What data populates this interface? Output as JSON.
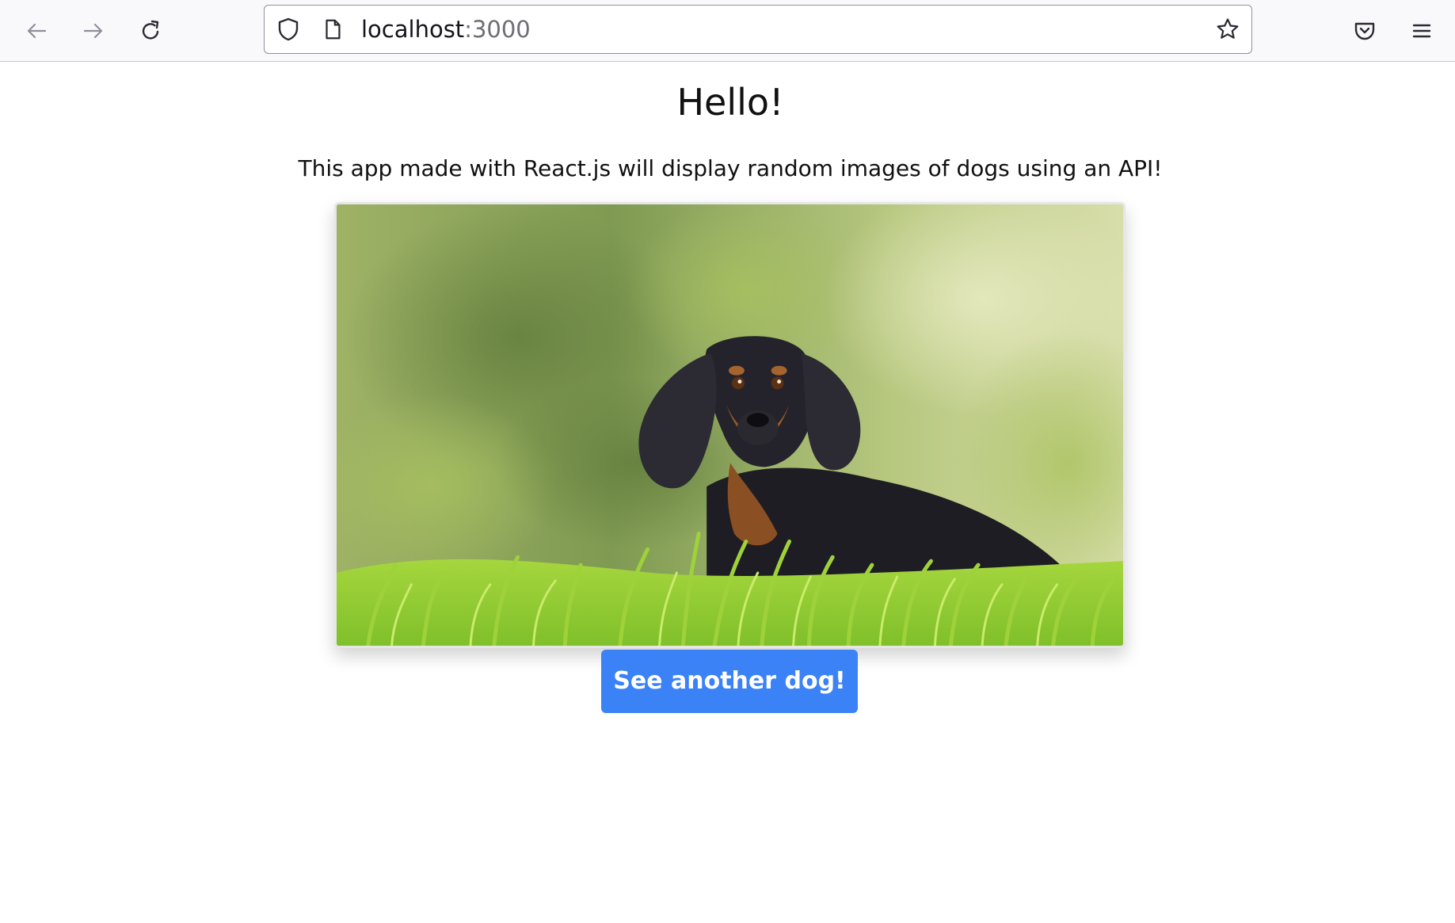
{
  "browser": {
    "url_host": "localhost",
    "url_port": ":3000",
    "icons": {
      "back": "arrow-left-icon",
      "forward": "arrow-right-icon",
      "reload": "reload-icon",
      "shield": "shield-icon",
      "page": "page-icon",
      "bookmark": "star-icon",
      "pocket": "pocket-icon",
      "menu": "hamburger-menu-icon"
    }
  },
  "page": {
    "heading": "Hello!",
    "subtitle": "This app made with React.js will display random images of dogs using an API!",
    "image": {
      "subject": "black and tan dachshund lying in green grass"
    },
    "button_label": "See another dog!"
  },
  "colors": {
    "accent": "#3b82f6",
    "button_text": "#ffffff",
    "text": "#111111",
    "toolbar_bg": "#f9f9fb"
  }
}
